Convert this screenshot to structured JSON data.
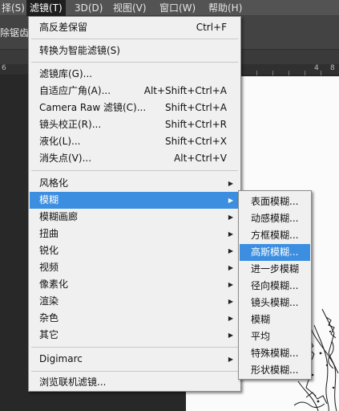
{
  "menubar": {
    "items": [
      {
        "label": "择(S)"
      },
      {
        "label": "滤镜(T)"
      },
      {
        "label": "3D(D)"
      },
      {
        "label": "视图(V)"
      },
      {
        "label": "窗口(W)"
      },
      {
        "label": "帮助(H)"
      }
    ]
  },
  "options_bar": {
    "text": "除锯齿"
  },
  "ruler": {
    "labels": [
      "6",
      "4",
      "8"
    ]
  },
  "filter_menu": {
    "items": [
      {
        "label": "高反差保留",
        "shortcut": "Ctrl+F"
      },
      {
        "label": "转换为智能滤镜(S)",
        "shortcut": ""
      },
      {
        "label": "滤镜库(G)...",
        "shortcut": ""
      },
      {
        "label": "自适应广角(A)...",
        "shortcut": "Alt+Shift+Ctrl+A"
      },
      {
        "label": "Camera Raw 滤镜(C)...",
        "shortcut": "Shift+Ctrl+A"
      },
      {
        "label": "镜头校正(R)...",
        "shortcut": "Shift+Ctrl+R"
      },
      {
        "label": "液化(L)...",
        "shortcut": "Shift+Ctrl+X"
      },
      {
        "label": "消失点(V)...",
        "shortcut": "Alt+Ctrl+V"
      },
      {
        "label": "风格化",
        "shortcut": ""
      },
      {
        "label": "模糊",
        "shortcut": ""
      },
      {
        "label": "模糊画廊",
        "shortcut": ""
      },
      {
        "label": "扭曲",
        "shortcut": ""
      },
      {
        "label": "锐化",
        "shortcut": ""
      },
      {
        "label": "视频",
        "shortcut": ""
      },
      {
        "label": "像素化",
        "shortcut": ""
      },
      {
        "label": "渲染",
        "shortcut": ""
      },
      {
        "label": "杂色",
        "shortcut": ""
      },
      {
        "label": "其它",
        "shortcut": ""
      },
      {
        "label": "Digimarc",
        "shortcut": ""
      },
      {
        "label": "浏览联机滤镜...",
        "shortcut": ""
      }
    ],
    "highlighted": "模糊",
    "submenu_arrow": "▶"
  },
  "blur_submenu": {
    "items": [
      {
        "label": "表面模糊..."
      },
      {
        "label": "动感模糊..."
      },
      {
        "label": "方框模糊..."
      },
      {
        "label": "高斯模糊..."
      },
      {
        "label": "进一步模糊"
      },
      {
        "label": "径向模糊..."
      },
      {
        "label": "镜头模糊..."
      },
      {
        "label": "模糊"
      },
      {
        "label": "平均"
      },
      {
        "label": "特殊模糊..."
      },
      {
        "label": "形状模糊..."
      }
    ],
    "highlighted": "高斯模糊..."
  },
  "colors": {
    "highlight": "#3b8ee0",
    "menu_bg": "#f0f0f0",
    "menubar_bg": "#535353",
    "workspace_bg": "#282828"
  }
}
